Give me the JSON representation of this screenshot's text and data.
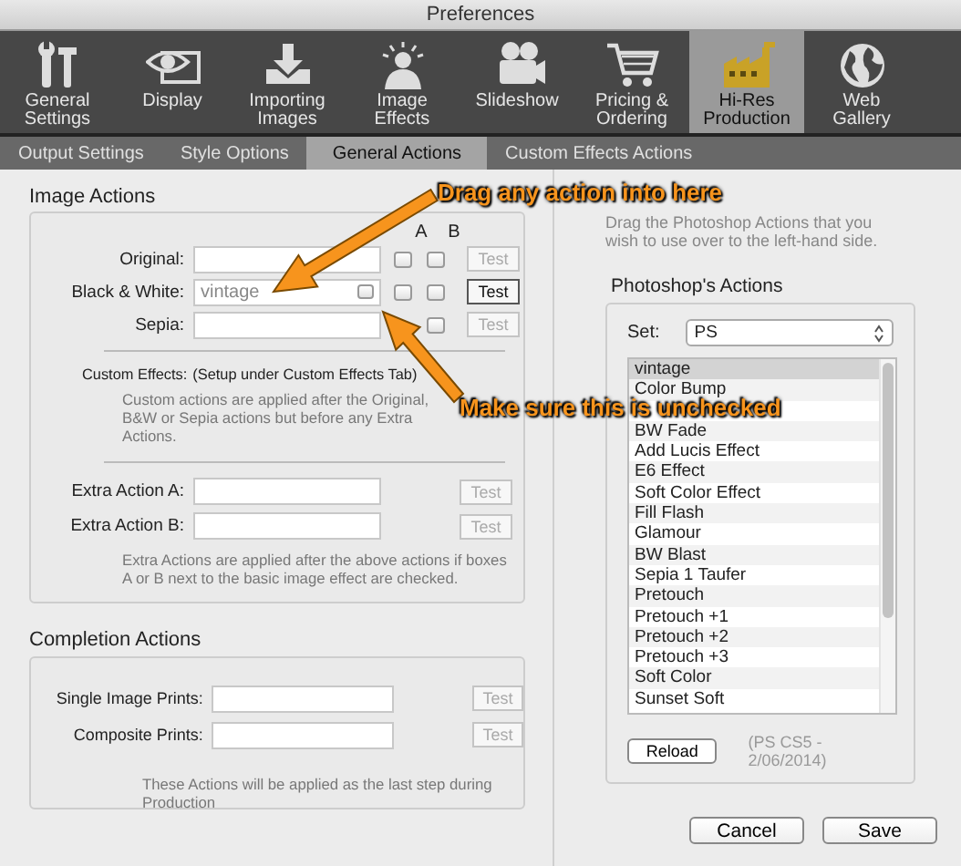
{
  "window": {
    "title": "Preferences"
  },
  "toolbar": [
    {
      "lines": [
        "General",
        "Settings"
      ],
      "selected": false
    },
    {
      "lines": [
        "Display"
      ],
      "selected": false
    },
    {
      "lines": [
        "Importing",
        "Images"
      ],
      "selected": false
    },
    {
      "lines": [
        "Image",
        "Effects"
      ],
      "selected": false
    },
    {
      "lines": [
        "Slideshow"
      ],
      "selected": false
    },
    {
      "lines": [
        "Pricing &",
        "Ordering"
      ],
      "selected": false
    },
    {
      "lines": [
        "Hi-Res",
        "Production"
      ],
      "selected": true
    },
    {
      "lines": [
        "Web",
        "Gallery"
      ],
      "selected": false
    }
  ],
  "subtabs": [
    {
      "label": "Output Settings",
      "selected": false
    },
    {
      "label": "Style Options",
      "selected": false
    },
    {
      "label": "General Actions",
      "selected": true
    },
    {
      "label": "Custom Effects Actions",
      "selected": false
    }
  ],
  "image_actions": {
    "title": "Image Actions",
    "column_a": "A",
    "column_b": "B",
    "rows": [
      {
        "label": "Original:",
        "a_checked": false,
        "b_checked": false,
        "test": {
          "label": "Test",
          "disabled": true
        }
      },
      {
        "label": "Black & White:",
        "value": "vintage",
        "inline_checked": false,
        "a_checked": false,
        "b_checked": false,
        "test": {
          "label": "Test",
          "disabled": false
        }
      },
      {
        "label": "Sepia:",
        "b_checked": false,
        "test": {
          "label": "Test",
          "disabled": true
        }
      }
    ],
    "custom_effects": {
      "label": "Custom Effects:",
      "note": "(Setup under Custom Effects Tab)",
      "description": "Custom actions are applied after the Original, B&W or Sepia actions but before any Extra Actions."
    },
    "extra_rows": [
      {
        "label": "Extra Action A:",
        "test": {
          "label": "Test",
          "disabled": true
        }
      },
      {
        "label": "Extra Action B:",
        "test": {
          "label": "Test",
          "disabled": true
        }
      }
    ],
    "extra_description": "Extra Actions are applied after the above actions if  boxes A or B next to the basic image effect are checked."
  },
  "completion_actions": {
    "title": "Completion Actions",
    "rows": [
      {
        "label": "Single Image Prints:",
        "test": {
          "label": "Test",
          "disabled": true
        }
      },
      {
        "label": "Composite Prints:",
        "test": {
          "label": "Test",
          "disabled": true
        }
      }
    ],
    "description": "These Actions will be applied as the last step during Production"
  },
  "photoshop": {
    "hint": "Drag the Photoshop Actions that you wish to use over to the left-hand side.",
    "title": "Photoshop's Actions",
    "set_label": "Set:",
    "set_value": "PS",
    "items": [
      {
        "label": "vintage",
        "selected": true
      },
      {
        "label": "Color Bump",
        "selected": false
      },
      {
        "selected": false
      },
      {
        "label": "BW Fade",
        "selected": false
      },
      {
        "label": "Add Lucis Effect",
        "selected": false
      },
      {
        "label": "E6 Effect",
        "selected": false
      },
      {
        "label": "Soft Color Effect",
        "selected": false
      },
      {
        "label": "Fill Flash",
        "selected": false
      },
      {
        "label": "Glamour",
        "selected": false
      },
      {
        "label": "BW Blast",
        "selected": false
      },
      {
        "label": "Sepia 1 Taufer",
        "selected": false
      },
      {
        "label": "Pretouch",
        "selected": false
      },
      {
        "label": "Pretouch +1",
        "selected": false
      },
      {
        "label": "Pretouch +2",
        "selected": false
      },
      {
        "label": "Pretouch +3",
        "selected": false
      },
      {
        "label": "Soft Color",
        "selected": false
      },
      {
        "label": "Sunset Soft",
        "selected": false
      }
    ],
    "reload": "Reload",
    "version": "(PS CS5 - 2/06/2014)"
  },
  "buttons": [
    "Cancel",
    "Save"
  ],
  "callouts": [
    "Drag any action into here",
    "Make sure this is unchecked"
  ]
}
